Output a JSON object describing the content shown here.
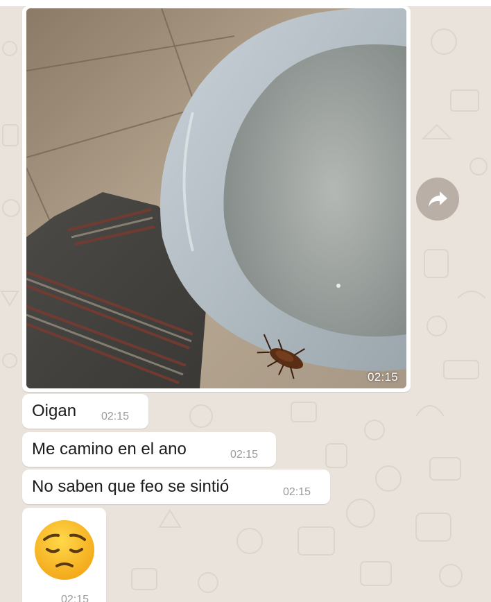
{
  "chat": {
    "background_color": "#e9e3dc",
    "bubble_color": "#ffffff"
  },
  "image_message": {
    "time": "02:15",
    "forward_icon": "forward-arrow-icon"
  },
  "messages": [
    {
      "text": "Oigan",
      "time": "02:15"
    },
    {
      "text": "Me camino en el ano",
      "time": "02:15"
    },
    {
      "text": "No saben que feo se sintió",
      "time": "02:15"
    }
  ],
  "emoji_message": {
    "emoji": "pensive-face-icon",
    "time": "02:15"
  }
}
